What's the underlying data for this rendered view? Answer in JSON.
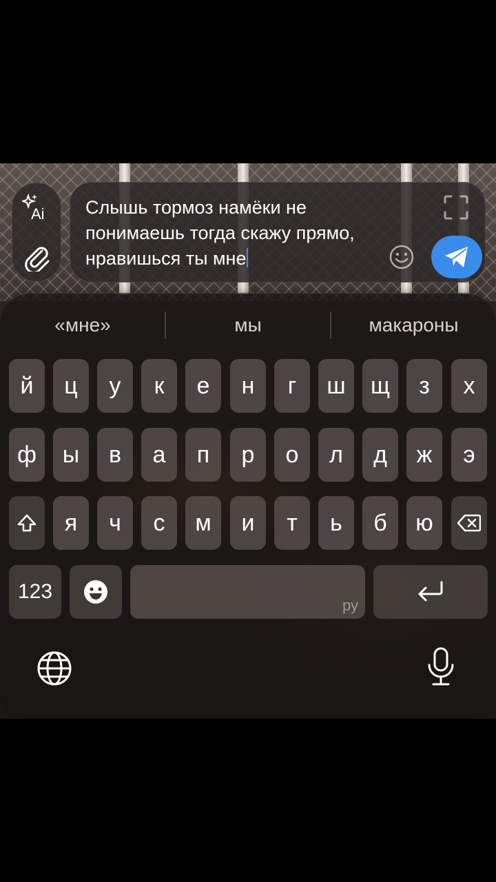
{
  "composer": {
    "text": "Слышь тормоз намёки не понимаешь тогда скажу прямо, нравишься ты мне"
  },
  "suggestions": [
    "«мне»",
    "мы",
    "макароны"
  ],
  "keyboard": {
    "row1": [
      "й",
      "ц",
      "у",
      "к",
      "е",
      "н",
      "г",
      "ш",
      "щ",
      "з",
      "х"
    ],
    "row2": [
      "ф",
      "ы",
      "в",
      "а",
      "п",
      "р",
      "о",
      "л",
      "д",
      "ж",
      "э"
    ],
    "row3": [
      "я",
      "ч",
      "с",
      "м",
      "и",
      "т",
      "ь",
      "б",
      "ю"
    ],
    "numbers_label": "123",
    "space_lang": "ру"
  },
  "icons": {
    "ai": "sparkle-ai-icon",
    "attach": "paperclip-icon",
    "expand": "expand-corners-icon",
    "emoji": "smiley-icon",
    "send": "paper-plane-icon",
    "shift": "shift-arrow-icon",
    "delete": "backspace-icon",
    "emoji_key": "emoji-face-icon",
    "return": "return-arrow-icon",
    "globe": "globe-icon",
    "mic": "microphone-icon"
  },
  "colors": {
    "send_button": "#3b8beb",
    "caret": "#4a86e8"
  }
}
